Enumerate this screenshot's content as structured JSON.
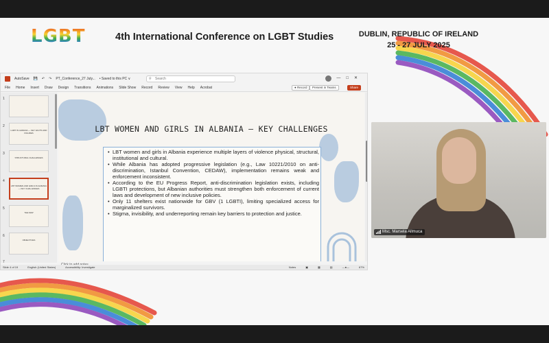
{
  "conference": {
    "logo_text": "LGBT",
    "title": "4th International Conference on LGBT Studies",
    "location": "DUBLIN, REPUBLIC OF IRELAND",
    "dates": "25 - 27 JULY 2025"
  },
  "powerpoint": {
    "autosave_label": "AutoSave",
    "filename": "PT_Conference_27 July...",
    "save_status": "• Saved to this PC ∨",
    "search_placeholder": "Search",
    "menu": [
      "File",
      "Home",
      "Insert",
      "Draw",
      "Design",
      "Transitions",
      "Animations",
      "Slide Show",
      "Record",
      "Review",
      "View",
      "Help",
      "Acrobat"
    ],
    "record_label": "Record",
    "present_label": "Present in Teams",
    "share_label": "Share",
    "thumbnails": [
      {
        "num": "1",
        "text": ""
      },
      {
        "num": "2",
        "text": "LGBT IN ALBANIA — KEY FACTS AND FIGURES"
      },
      {
        "num": "3",
        "text": "STRUCTURAL CHALLENGES"
      },
      {
        "num": "4",
        "text": "LBT WOMEN AND GIRLS IN ALBANIA — KEY CHALLENGES"
      },
      {
        "num": "5",
        "text": "THE MAP"
      },
      {
        "num": "6",
        "text": "OBJECTIVES"
      },
      {
        "num": "7",
        "text": ""
      }
    ],
    "slide": {
      "title": "LBT WOMEN AND GIRLS IN ALBANIA — KEY CHALLENGES",
      "bullets": [
        "LBT women and girls in Albania experience multiple layers of violence physical, structural, institutional and cultural.",
        "While Albania has adopted progressive legislation (e.g., Law 10221/2010 on anti-discrimination, Istanbul Convention, CEDAW), implementation remains weak and enforcement inconsistent.",
        "According to the EU Progress Report, anti-discrimination legislation exists, including LGBTI protections, but Albanian authorities must strengthen both enforcement of current laws and development of new inclusive policies.",
        "Only 11 shelters exist nationwide for GBV (1 LGBTI), limiting specialized access for marginalized survivors.",
        "Stigma, invisibility, and underreporting remain key barriers to protection and justice."
      ]
    },
    "notes_placeholder": "Click to add notes",
    "status": {
      "slide_of": "Slide 4 of 19",
      "language": "English (United States)",
      "accessibility": "Accessibility: Investigate",
      "notes": "Notes",
      "zoom": "67%"
    }
  },
  "video": {
    "participant_name": "Msc. Marsela Allmuca"
  },
  "colors": {
    "office_red": "#c43e1c",
    "blob_blue": "#a9c2dc",
    "textbox_border": "#8ab0d8"
  }
}
